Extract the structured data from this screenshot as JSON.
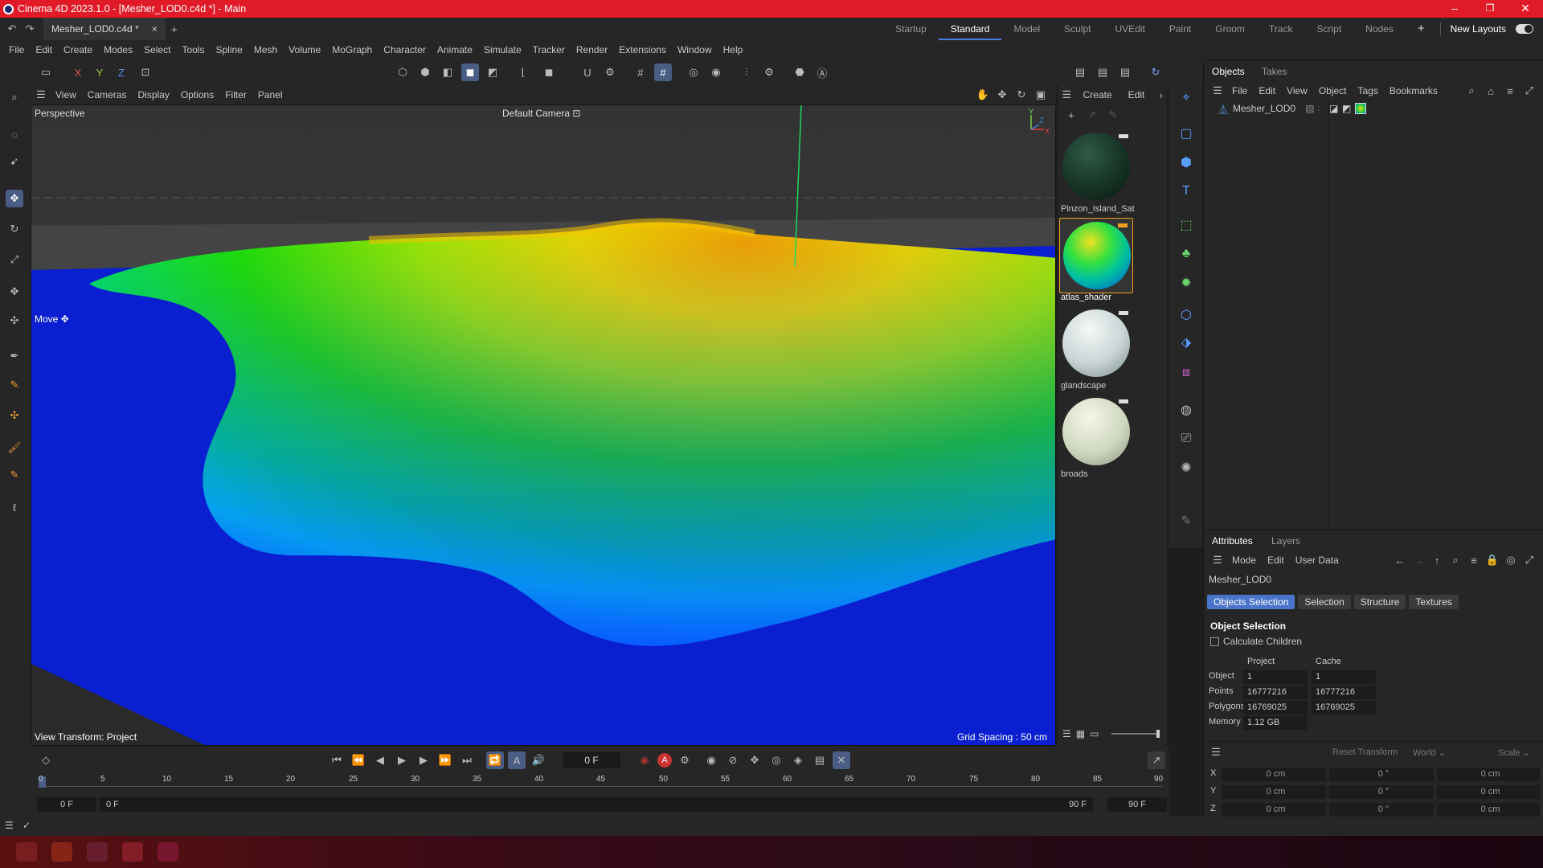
{
  "window": {
    "title": "Cinema 4D 2023.1.0 - [Mesher_LOD0.c4d *] - Main",
    "controls": [
      "–",
      "❐",
      "✕"
    ]
  },
  "tabs": {
    "document": "Mesher_LOD0.c4d *",
    "close": "×",
    "add": "+",
    "layouts": [
      "Startup",
      "Standard",
      "Model",
      "Sculpt",
      "UVEdit",
      "Paint",
      "Groom",
      "Track",
      "Script",
      "Nodes"
    ],
    "active_layout": "Standard",
    "add_layout": "+",
    "new_layouts": "New Layouts"
  },
  "menu": [
    "File",
    "Edit",
    "Create",
    "Modes",
    "Select",
    "Tools",
    "Spline",
    "Mesh",
    "Volume",
    "MoGraph",
    "Character",
    "Animate",
    "Simulate",
    "Tracker",
    "Render",
    "Extensions",
    "Window",
    "Help"
  ],
  "toolbar": {
    "axis_x": "X",
    "axis_y": "Y",
    "axis_z": "Z"
  },
  "viewport": {
    "menu": [
      "View",
      "Cameras",
      "Display",
      "Options",
      "Filter",
      "Panel"
    ],
    "label": "Perspective",
    "camera": "Default Camera",
    "camera_icon": "⊡",
    "tool_hint": "Move",
    "view_transform": "View Transform: Project",
    "grid_spacing": "Grid Spacing : 50 cm",
    "axis_labels": {
      "y": "Y",
      "z": "Z",
      "x": "X"
    }
  },
  "materials": {
    "menu": [
      "Create",
      "Edit"
    ],
    "items": [
      {
        "name": "Pinzon_Island_Sat",
        "selected": false
      },
      {
        "name": "atlas_shader",
        "selected": true
      },
      {
        "name": "glandscape",
        "selected": false
      },
      {
        "name": "broads",
        "selected": false
      }
    ]
  },
  "objects": {
    "tabs": [
      "Objects",
      "Takes"
    ],
    "menu": [
      "File",
      "Edit",
      "View",
      "Object",
      "Tags",
      "Bookmarks"
    ],
    "items": [
      {
        "name": "Mesher_LOD0"
      }
    ]
  },
  "attributes": {
    "tabs": [
      "Attributes",
      "Layers"
    ],
    "menu": [
      "Mode",
      "Edit",
      "User Data"
    ],
    "object_name": "Mesher_LOD0",
    "subtabs": [
      "Objects Selection",
      "Selection",
      "Structure",
      "Textures"
    ],
    "active_subtab": "Objects Selection",
    "section": "Object Selection",
    "checkbox_label": "Calculate Children",
    "col_headers": [
      "Project",
      "Cache"
    ],
    "rows": [
      {
        "label": "Object",
        "project": "1",
        "cache": "1"
      },
      {
        "label": "Points",
        "project": "16777216",
        "cache": "16777216"
      },
      {
        "label": "Polygons",
        "project": "16769025",
        "cache": "16769025"
      },
      {
        "label": "Memory",
        "project": "1.12 GB",
        "cache": ""
      }
    ]
  },
  "coords": {
    "reset": "Reset Transform",
    "world": "World",
    "scale": "Scale",
    "rows": [
      {
        "axis": "X",
        "pos": "0 cm",
        "rot": "0 °",
        "scale": "0 cm"
      },
      {
        "axis": "Y",
        "pos": "0 cm",
        "rot": "0 °",
        "scale": "0 cm"
      },
      {
        "axis": "Z",
        "pos": "0 cm",
        "rot": "0 °",
        "scale": "0 cm"
      }
    ]
  },
  "timeline": {
    "current_frame": "0 F",
    "ticks": [
      "0",
      "5",
      "10",
      "15",
      "20",
      "25",
      "30",
      "35",
      "40",
      "45",
      "50",
      "55",
      "60",
      "65",
      "70",
      "75",
      "80",
      "85",
      "90"
    ],
    "start_min": "0 F",
    "start": "0 F",
    "end": "90 F",
    "end_max": "90 F"
  },
  "colors": {
    "titlebar": "#e11a27",
    "accent": "#4a74c9",
    "water": "#0a1fd0",
    "terrain_high": "#e6b400",
    "terrain_mid": "#22e000",
    "terrain_low": "#00e8f0"
  }
}
